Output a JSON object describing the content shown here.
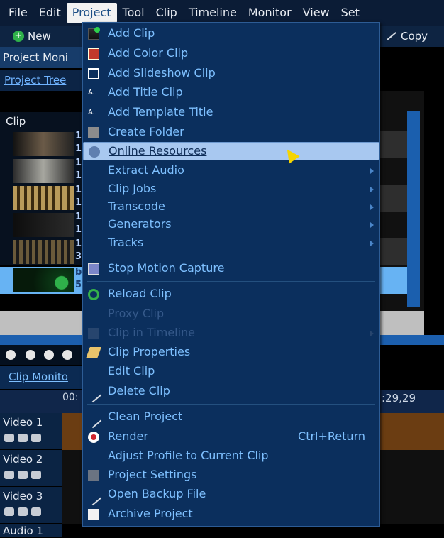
{
  "menubar": {
    "items": [
      {
        "label": "File"
      },
      {
        "label": "Edit"
      },
      {
        "label": "Project"
      },
      {
        "label": "Tool"
      },
      {
        "label": "Clip"
      },
      {
        "label": "Timeline"
      },
      {
        "label": "Monitor"
      },
      {
        "label": "View"
      },
      {
        "label": "Set"
      }
    ]
  },
  "toolbar": {
    "new_label": "New",
    "copy_label": "Copy"
  },
  "dock": {
    "tabs_label": "Project Moni",
    "tree_title": "Project Tree",
    "bin_column": "Clip",
    "clip_numbers": [
      "1",
      "1",
      "1",
      "1",
      "1",
      "1",
      "1",
      "1",
      "1",
      "3",
      "b",
      "5"
    ]
  },
  "clip_monitor": {
    "tab_label": "Clip Monito"
  },
  "timeline": {
    "ruler_left": "00:",
    "ruler_right": ":29,29",
    "tracks": [
      {
        "name": "Video 1"
      },
      {
        "name": "Video 2"
      },
      {
        "name": "Video 3"
      },
      {
        "name": "Audio 1"
      }
    ]
  },
  "project_menu": {
    "items": [
      {
        "label": "Add Clip",
        "icon": "add-clip-icon"
      },
      {
        "label": "Add Color Clip",
        "icon": "color-clip-icon"
      },
      {
        "label": "Add Slideshow Clip",
        "icon": "slideshow-icon"
      },
      {
        "label": "Add Title Clip",
        "icon": "title-clip-icon"
      },
      {
        "label": "Add Template Title",
        "icon": "template-title-icon"
      },
      {
        "label": "Create Folder",
        "icon": "folder-icon"
      },
      {
        "label": "Online Resources",
        "icon": "online-resources-icon",
        "highlighted": true
      },
      {
        "label": "Extract Audio",
        "submenu": true
      },
      {
        "label": "Clip Jobs",
        "submenu": true
      },
      {
        "label": "Transcode",
        "submenu": true
      },
      {
        "label": "Generators",
        "submenu": true
      },
      {
        "label": "Tracks",
        "submenu": true
      },
      {
        "label": "Stop Motion Capture",
        "icon": "stop-motion-icon"
      },
      {
        "label": "Reload Clip",
        "icon": "reload-icon"
      },
      {
        "label": "Proxy Clip",
        "disabled": true
      },
      {
        "label": "Clip in Timeline",
        "disabled": true,
        "submenu": true
      },
      {
        "label": "Clip Properties",
        "icon": "properties-icon"
      },
      {
        "label": "Edit Clip"
      },
      {
        "label": "Delete Clip",
        "icon": "delete-icon"
      },
      {
        "label": "Clean Project",
        "icon": "clean-icon"
      },
      {
        "label": "Render",
        "icon": "render-icon",
        "shortcut": "Ctrl+Return"
      },
      {
        "label": "Adjust Profile to Current Clip"
      },
      {
        "label": "Project Settings",
        "icon": "settings-icon"
      },
      {
        "label": "Open Backup File",
        "icon": "backup-icon"
      },
      {
        "label": "Archive Project",
        "icon": "archive-icon"
      }
    ]
  },
  "colors": {
    "menu_bg": "#0b2f5d",
    "menu_text": "#7ec0ff",
    "highlight_bg": "#a8c8f0",
    "menubar_bg": "#0b1c36"
  }
}
